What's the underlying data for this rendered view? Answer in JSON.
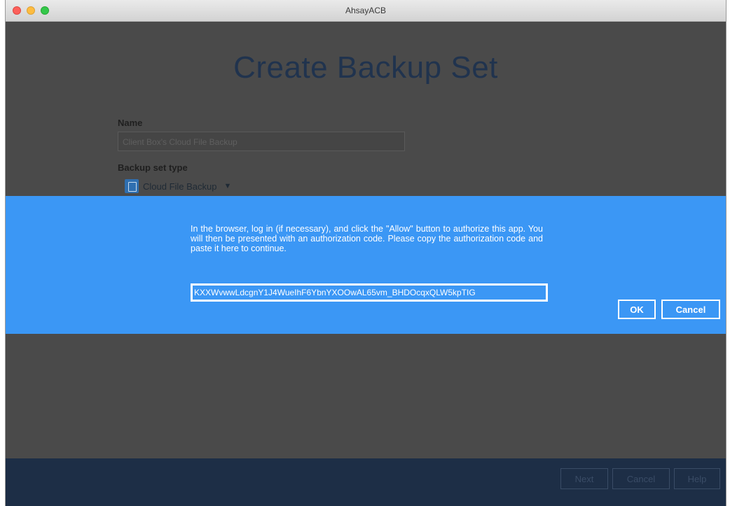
{
  "window": {
    "title": "AhsayACB"
  },
  "page": {
    "title": "Create Backup Set"
  },
  "form": {
    "name_label": "Name",
    "name_value": "Client Box's Cloud File Backup",
    "type_label": "Backup set type",
    "type_value": "Cloud File Backup",
    "type_icon": "cloud-file-backup-icon"
  },
  "dialog": {
    "message": "In the browser, log in (if necessary), and click the \"Allow\" button to authorize this app. You will then be presented with an authorization code. Please copy the authorization code and paste it here to continue.",
    "auth_code": "KXXWvwwLdcgnY1J4WueIhF6YbnYXOOwAL65vm_BHDOcqxQLW5kpTIG",
    "ok_label": "OK",
    "cancel_label": "Cancel",
    "background": "#3b97f5"
  },
  "footer": {
    "next_label": "Next",
    "cancel_label": "Cancel",
    "help_label": "Help"
  }
}
